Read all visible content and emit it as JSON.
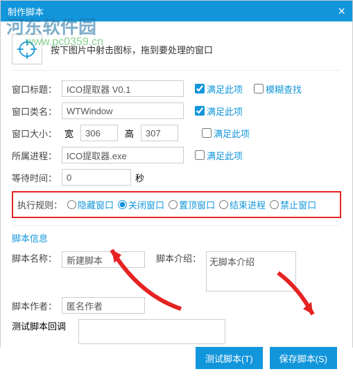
{
  "title": "制作脚本",
  "watermark": {
    "name": "河东软件园",
    "url": "www.pc0359.cn"
  },
  "intro": "按下图片中射击图标，拖到要处理的窗口",
  "fields": {
    "windowTitle": {
      "label": "窗口标题：",
      "value": "ICO提取器 V0.1"
    },
    "windowClass": {
      "label": "窗口类名：",
      "value": "WTWindow"
    },
    "windowSize": {
      "label": "窗口大小：",
      "wLabel": "宽",
      "w": "306",
      "hLabel": "高",
      "h": "307"
    },
    "process": {
      "label": "所属进程：",
      "value": "ICO提取器.exe"
    },
    "wait": {
      "label": "等待时间：",
      "value": "0",
      "unit": "秒"
    }
  },
  "checks": {
    "satisfy": "满足此项",
    "fuzzy": "模糊查找"
  },
  "rules": {
    "label": "执行规则：",
    "options": [
      "隐藏窗口",
      "关闭窗口",
      "置顶窗口",
      "结束进程",
      "禁止窗口"
    ],
    "selected": 1
  },
  "section": "脚本信息",
  "script": {
    "nameLabel": "脚本名称：",
    "name": "新建脚本",
    "introLabel": "脚本介绍：",
    "intro": "无脚本介绍",
    "authorLabel": "脚本作者：",
    "author": "匿名作者",
    "callbackLabel": "测试脚本回调",
    "callback": ""
  },
  "buttons": {
    "test": "测试脚本(T)",
    "save": "保存脚本(S)"
  }
}
